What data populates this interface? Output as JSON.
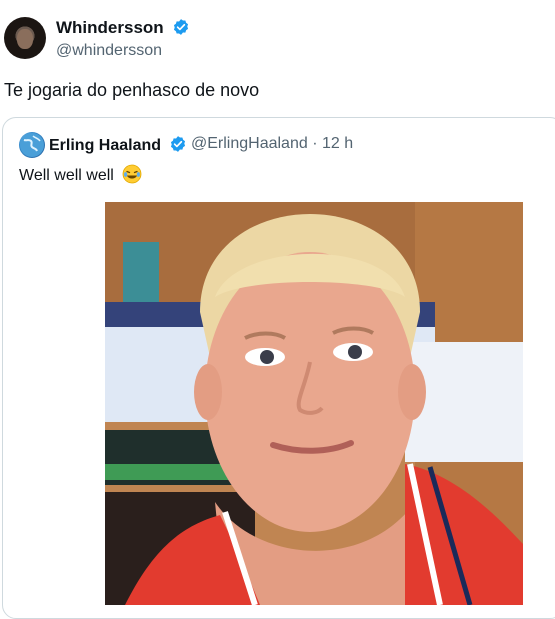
{
  "tweet": {
    "author_name": "Whindersson",
    "author_handle": "@whindersson",
    "text": "Te jogaria do penhasco de novo"
  },
  "quoted_tweet": {
    "author_name": "Erling Haaland",
    "author_handle": "@ErlingHaaland",
    "separator": "·",
    "time": "12 h",
    "text": "Well well well",
    "emoji": "face-with-tears-of-joy"
  },
  "colors": {
    "verified": "#1d9bf0",
    "secondary_text": "#536471",
    "border": "#cfd9de"
  }
}
